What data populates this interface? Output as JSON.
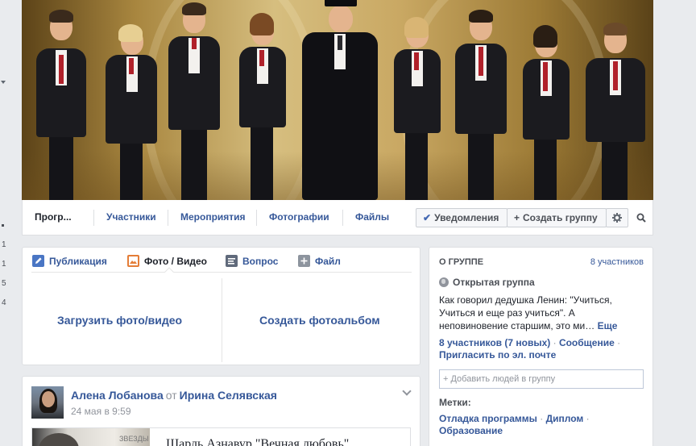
{
  "left_rail": {
    "numbers": [
      "1",
      "1",
      "5",
      "4"
    ]
  },
  "navbar": {
    "items": [
      "Прогр...",
      "Участники",
      "Мероприятия",
      "Фотографии",
      "Файлы"
    ],
    "notifications_label": "Уведомления",
    "create_group_label": "Создать группу"
  },
  "composer": {
    "tabs": [
      "Публикация",
      "Фото / Видео",
      "Вопрос",
      "Файл"
    ],
    "active_tab": "Фото / Видео",
    "upload_label": "Загрузить фото/видео",
    "album_label": "Создать фотоальбом"
  },
  "post": {
    "author": "Алена Лобанова",
    "from_word": "от",
    "target": "Ирина Селявская",
    "time": "24 мая в 9:59",
    "shared_title": "Шарль Азнавур \"Вечная любовь\"",
    "thumb_caption": "ЗВЕЗДЫ"
  },
  "about": {
    "heading": "О ГРУППЕ",
    "members_count": "8 участников",
    "privacy": "Открытая группа",
    "description": "Как говорил дедушка Ленин: \"Учиться, Учиться и еще раз учиться\". А неповиновение старшим, это ми…",
    "more_label": "Еще",
    "members_link": "8 участников (7 новых)",
    "messages_link": "Сообщение",
    "invite_link": "Пригласить по эл. почте",
    "add_people_placeholder": "+ Добавить людей в группу",
    "tags_heading": "Метки:",
    "tags": [
      "Отладка программы",
      "Диплом",
      "Образование"
    ]
  },
  "colors": {
    "link": "#365899",
    "background": "#e9ebee",
    "tie": "#b0212a"
  }
}
